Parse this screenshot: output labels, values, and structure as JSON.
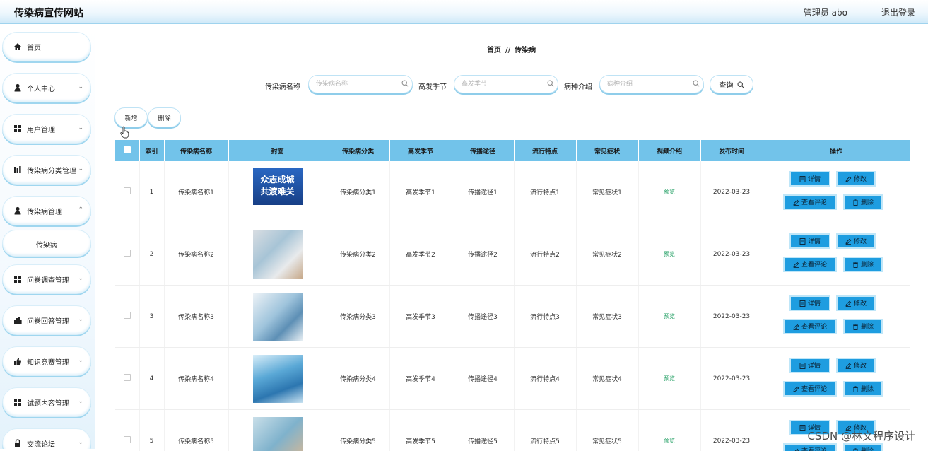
{
  "header": {
    "site_title": "传染病宣传网站",
    "admin": "管理员 abo",
    "logout": "退出登录"
  },
  "sidebar": {
    "items": [
      {
        "label": "首页",
        "icon": "home-icon",
        "expandable": false
      },
      {
        "label": "个人中心",
        "icon": "person-icon",
        "expandable": true
      },
      {
        "label": "用户管理",
        "icon": "grid-icon",
        "expandable": true
      },
      {
        "label": "传染病分类管理",
        "icon": "chart-icon",
        "expandable": true
      },
      {
        "label": "传染病管理",
        "icon": "person-icon",
        "expandable": true
      },
      {
        "label": "传染病",
        "icon": "",
        "expandable": false,
        "sub": true
      },
      {
        "label": "问卷调查管理",
        "icon": "grid-icon",
        "expandable": true
      },
      {
        "label": "问卷回答管理",
        "icon": "bar-icon",
        "expandable": true
      },
      {
        "label": "知识竞赛管理",
        "icon": "thumb-icon",
        "expandable": true
      },
      {
        "label": "试题内容管理",
        "icon": "grid-icon",
        "expandable": true
      },
      {
        "label": "交流论坛",
        "icon": "lock-icon",
        "expandable": true
      }
    ]
  },
  "breadcrumb": {
    "home": "首页",
    "sep": "//",
    "current": "传染病"
  },
  "search": {
    "name_label": "传染病名称",
    "name_placeholder": "传染病名称",
    "season_label": "高发季节",
    "season_placeholder": "高发季节",
    "intro_label": "病种介绍",
    "intro_placeholder": "病种介绍",
    "query_label": "查询"
  },
  "actions": {
    "add": "新增",
    "delete": "删除"
  },
  "table": {
    "headers": [
      "",
      "索引",
      "传染病名称",
      "封面",
      "传染病分类",
      "高发季节",
      "传播途径",
      "流行特点",
      "常见症状",
      "视频介绍",
      "发布时间",
      "操作"
    ],
    "rows": [
      {
        "index": "1",
        "name": "传染病名称1",
        "cover_text": "众志成城 共渡难关",
        "category": "传染病分类1",
        "season": "高发季节1",
        "route": "传播途径1",
        "feature": "流行特点1",
        "symptom": "常见症状1",
        "video": "预览",
        "date": "2022-03-23"
      },
      {
        "index": "2",
        "name": "传染病名称2",
        "cover_text": "",
        "category": "传染病分类2",
        "season": "高发季节2",
        "route": "传播途径2",
        "feature": "流行特点2",
        "symptom": "常见症状2",
        "video": "预览",
        "date": "2022-03-23"
      },
      {
        "index": "3",
        "name": "传染病名称3",
        "cover_text": "",
        "category": "传染病分类3",
        "season": "高发季节3",
        "route": "传播途径3",
        "feature": "流行特点3",
        "symptom": "常见症状3",
        "video": "预览",
        "date": "2022-03-23"
      },
      {
        "index": "4",
        "name": "传染病名称4",
        "cover_text": "",
        "category": "传染病分类4",
        "season": "高发季节4",
        "route": "传播途径4",
        "feature": "流行特点4",
        "symptom": "常见症状4",
        "video": "预览",
        "date": "2022-03-23"
      },
      {
        "index": "5",
        "name": "传染病名称5",
        "cover_text": "",
        "category": "传染病分类5",
        "season": "高发季节5",
        "route": "传播途径5",
        "feature": "流行特点5",
        "symptom": "常见症状5",
        "video": "预览",
        "date": "2022-03-23"
      }
    ],
    "ops": {
      "detail": "详情",
      "edit": "修改",
      "comments": "查看评论",
      "remove": "删除"
    }
  },
  "watermark": "CSDN @林文程序设计",
  "colors": {
    "header_blue": "#72c3ea",
    "button_blue": "#1e9de0",
    "preview_green": "#2ba36a",
    "accent_border": "#8fcdea"
  }
}
